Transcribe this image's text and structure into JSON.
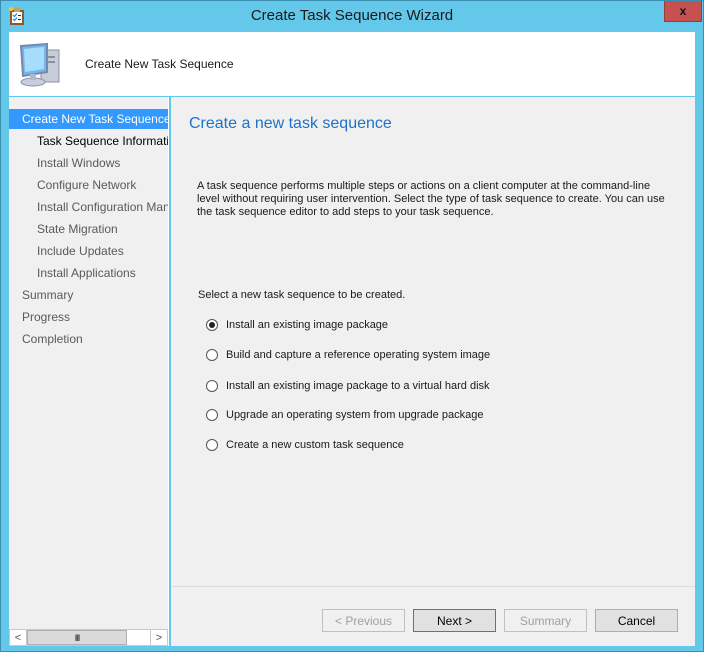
{
  "window": {
    "title": "Create Task Sequence Wizard",
    "close_label": "x",
    "icons": {
      "title_icon": "task-list-clipboard-icon",
      "header_icon": "computer-icon"
    }
  },
  "header": {
    "title": "Create New Task Sequence"
  },
  "sidebar": {
    "items": [
      {
        "label": "Create New Task Sequence",
        "level": 0,
        "state": "active"
      },
      {
        "label": "Task Sequence Information",
        "level": 1,
        "state": "current"
      },
      {
        "label": "Install Windows",
        "level": 1,
        "state": "normal"
      },
      {
        "label": "Configure Network",
        "level": 1,
        "state": "normal"
      },
      {
        "label": "Install Configuration Manager",
        "level": 1,
        "state": "normal"
      },
      {
        "label": "State Migration",
        "level": 1,
        "state": "normal"
      },
      {
        "label": "Include Updates",
        "level": 1,
        "state": "normal"
      },
      {
        "label": "Install Applications",
        "level": 1,
        "state": "normal"
      },
      {
        "label": "Summary",
        "level": 0,
        "state": "normal"
      },
      {
        "label": "Progress",
        "level": 0,
        "state": "normal"
      },
      {
        "label": "Completion",
        "level": 0,
        "state": "normal"
      }
    ],
    "scrollbar": {
      "left": "<",
      "right": ">",
      "grip": "III"
    }
  },
  "content": {
    "title": "Create a new task sequence",
    "description": "A task sequence performs multiple steps or actions on a client computer at the command-line level without requiring user intervention. Select the type of task sequence to create. You can use the task sequence editor to add steps to your task sequence.",
    "prompt": "Select a new task sequence to be created.",
    "options": [
      {
        "label": "Install an existing image package",
        "selected": true
      },
      {
        "label": "Build and capture a reference operating system image",
        "selected": false
      },
      {
        "label": "Install an existing image package to a virtual hard disk",
        "selected": false
      },
      {
        "label": "Upgrade an operating system from upgrade package",
        "selected": false
      },
      {
        "label": "Create a new custom task sequence",
        "selected": false
      }
    ]
  },
  "buttons": {
    "previous": "< Previous",
    "next": "Next >",
    "summary": "Summary",
    "cancel": "Cancel"
  }
}
